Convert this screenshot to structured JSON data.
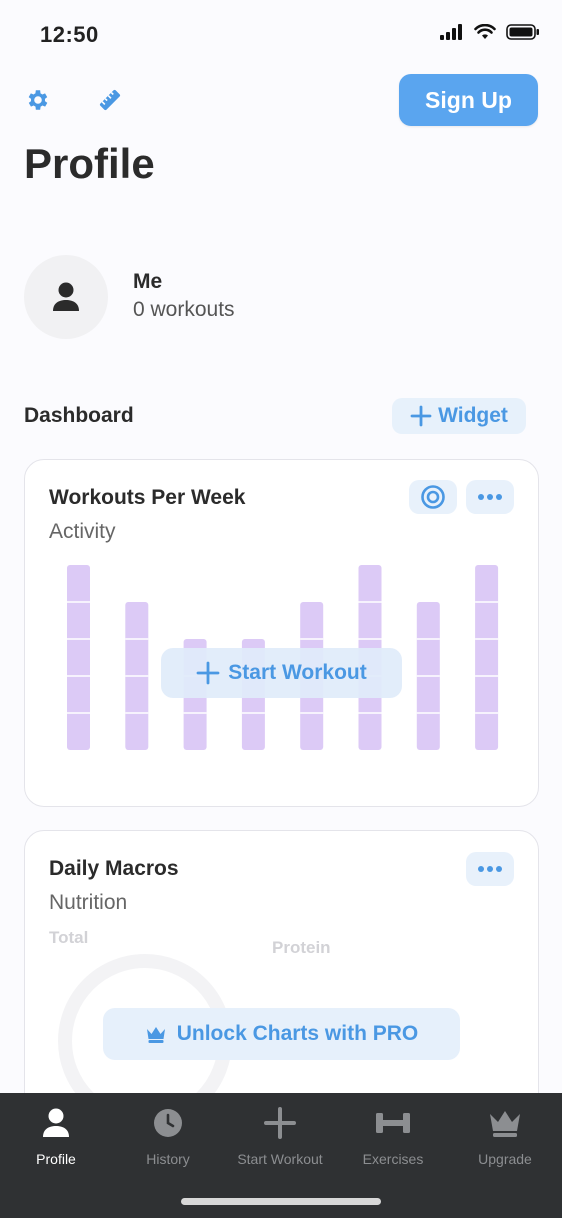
{
  "status": {
    "time": "12:50"
  },
  "header": {
    "signup_label": "Sign Up",
    "title": "Profile"
  },
  "user": {
    "name": "Me",
    "workouts": "0 workouts"
  },
  "dashboard": {
    "title": "Dashboard",
    "add_widget_label": "Widget"
  },
  "workouts_card": {
    "title": "Workouts Per Week",
    "subtitle": "Activity",
    "start_workout_label": "Start Workout",
    "bar_color": "#dccaf6"
  },
  "chart_data": {
    "type": "bar",
    "title": "Workouts Per Week",
    "subtitle": "Activity",
    "categories": [
      "",
      "",
      "",
      "",
      "",
      "",
      "",
      ""
    ],
    "values": [
      5,
      4,
      3,
      3,
      4,
      5,
      4,
      5
    ],
    "ylim": [
      0,
      5
    ],
    "note": "placeholder (empty-state) bars"
  },
  "macros_card": {
    "title": "Daily Macros",
    "subtitle": "Nutrition",
    "label_total": "Total",
    "label_protein": "Protein",
    "unlock_label": "Unlock Charts with PRO"
  },
  "tabs": [
    {
      "label": "Profile",
      "icon": "person-icon",
      "active": true
    },
    {
      "label": "History",
      "icon": "clock-icon",
      "active": false
    },
    {
      "label": "Start Workout",
      "icon": "plus-icon",
      "active": false
    },
    {
      "label": "Exercises",
      "icon": "dumbbell-icon",
      "active": false
    },
    {
      "label": "Upgrade",
      "icon": "crown-icon",
      "active": false
    }
  ],
  "colors": {
    "accent": "#5aa5ef",
    "accent_text": "#4a98e3",
    "tab_bar": "#2f3133"
  }
}
